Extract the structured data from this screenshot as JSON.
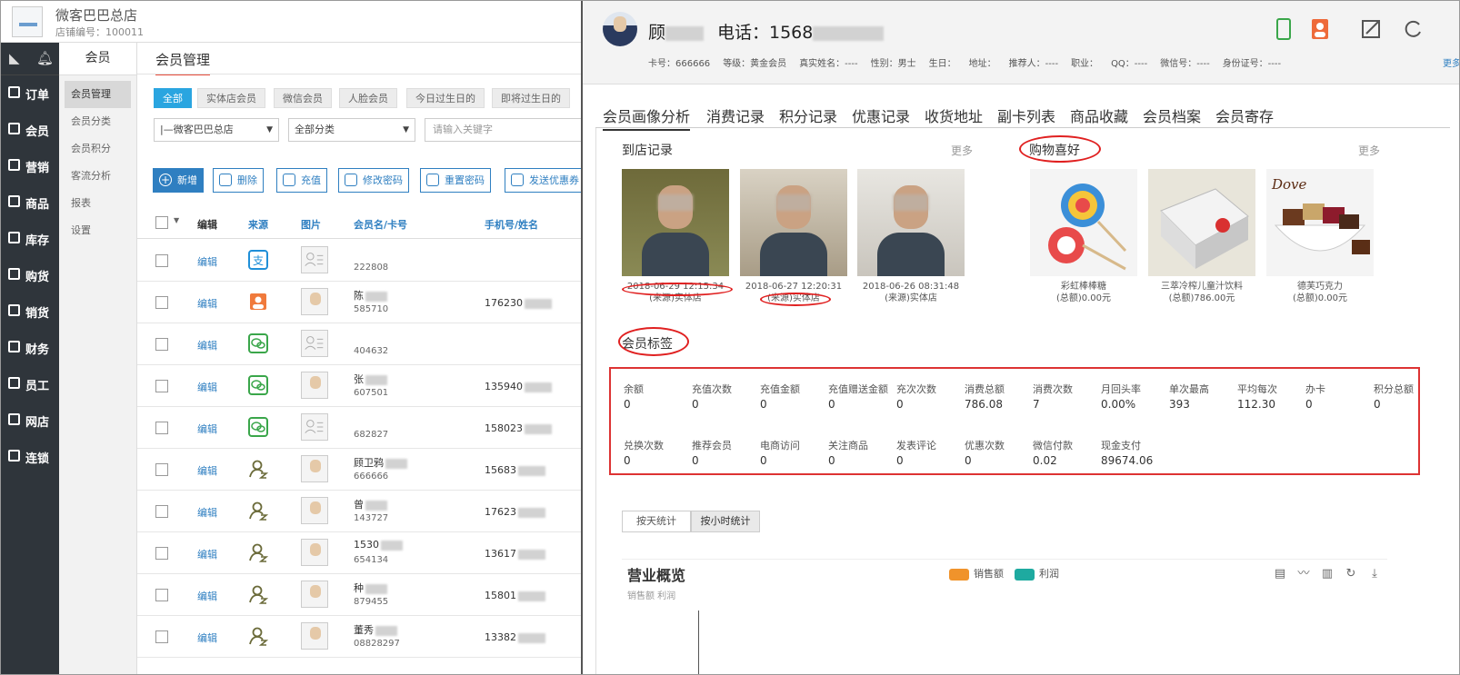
{
  "app": {
    "store_name": "微客巴巴总店",
    "store_no": "店铺编号：100011"
  },
  "nav": {
    "items": [
      {
        "label": "订单",
        "icon": "order-icon"
      },
      {
        "label": "会员",
        "icon": "member-icon"
      },
      {
        "label": "营销",
        "icon": "gift-icon"
      },
      {
        "label": "商品",
        "icon": "product-icon"
      },
      {
        "label": "库存",
        "icon": "warehouse-icon"
      },
      {
        "label": "购货",
        "icon": "purchase-icon"
      },
      {
        "label": "销货",
        "icon": "sales-icon"
      },
      {
        "label": "财务",
        "icon": "finance-icon"
      },
      {
        "label": "员工",
        "icon": "staff-icon"
      },
      {
        "label": "网店",
        "icon": "phone-icon"
      },
      {
        "label": "连锁",
        "icon": "chain-icon"
      }
    ]
  },
  "subnav": {
    "title": "会员",
    "items": [
      "会员管理",
      "会员分类",
      "会员积分",
      "客流分析",
      "报表",
      "设置"
    ]
  },
  "main": {
    "title": "会员管理",
    "filters": [
      "全部",
      "实体店会员",
      "微信会员",
      "人脸会员",
      "今日过生日的",
      "即将过生日的"
    ],
    "store_select": "|—微客巴巴总店",
    "category_select": "全部分类",
    "search_placeholder": "请输入关键字",
    "actions": [
      "新增",
      "删除",
      "充值",
      "修改密码",
      "重置密码",
      "发送优惠券"
    ],
    "columns": {
      "edit": "编辑",
      "source": "来源",
      "picture": "图片",
      "name_card": "会员名/卡号",
      "phone_name": "手机号/姓名"
    },
    "rows": [
      {
        "edit": "编辑",
        "source": "alipay",
        "photo": "placeholder",
        "name": "",
        "card": "222808",
        "phone": ""
      },
      {
        "edit": "编辑",
        "source": "face",
        "photo": "face",
        "name": "陈",
        "card": "585710",
        "phone": "176230"
      },
      {
        "edit": "编辑",
        "source": "wechat",
        "photo": "placeholder",
        "name": "",
        "card": "404632",
        "phone": ""
      },
      {
        "edit": "编辑",
        "source": "wechat",
        "photo": "face",
        "name": "张",
        "card": "607501",
        "phone": "135940"
      },
      {
        "edit": "编辑",
        "source": "wechat",
        "photo": "placeholder",
        "name": "",
        "card": "682827",
        "phone": "158023"
      },
      {
        "edit": "编辑",
        "source": "user",
        "photo": "face",
        "name": "顾卫鸦",
        "card": "666666",
        "phone": "15683"
      },
      {
        "edit": "编辑",
        "source": "user",
        "photo": "face",
        "name": "曾",
        "card": "143727",
        "phone": "17623"
      },
      {
        "edit": "编辑",
        "source": "user",
        "photo": "face",
        "name": "1530",
        "card": "654134",
        "phone": "13617"
      },
      {
        "edit": "编辑",
        "source": "user",
        "photo": "face",
        "name": "种",
        "card": "879455",
        "phone": "15801"
      },
      {
        "edit": "编辑",
        "source": "user",
        "photo": "face",
        "name": "董秀",
        "card": "08828297",
        "phone": "13382"
      }
    ]
  },
  "panel": {
    "name": "顾",
    "phone": "电话：1568",
    "info": [
      "卡号：666666",
      "等级：黄金会员",
      "真实姓名：----",
      "性别：男士",
      "生日：",
      "地址：",
      "推荐人：----",
      "职业：",
      "QQ：----",
      "微信号：----",
      "身份证号：----"
    ],
    "more": "更多",
    "tabs": [
      "会员画像分析",
      "消费记录",
      "积分记录",
      "优惠记录",
      "收货地址",
      "副卡列表",
      "商品收藏",
      "会员档案",
      "会员寄存"
    ],
    "visits_title": "到店记录",
    "visits_more": "更多",
    "visits": [
      {
        "time": "2018-06-29 12:15:34",
        "source": "(来源)实体店"
      },
      {
        "time": "2018-06-27 12:20:31",
        "source": "(来源)实体店"
      },
      {
        "time": "2018-06-26 08:31:48",
        "source": "(来源)实体店"
      }
    ],
    "prefs_title": "购物喜好",
    "prefs_more": "更多",
    "prefs": [
      {
        "name": "彩虹棒棒糖",
        "amount": "(总额)0.00元"
      },
      {
        "name": "三萃冷榨儿童汁饮料",
        "amount": "(总额)786.00元"
      },
      {
        "name": "德芙巧克力",
        "amount": "(总额)0.00元",
        "brand": "Dove"
      }
    ],
    "tags_title": "会员标签",
    "stats": [
      {
        "label": "余额",
        "value": "0"
      },
      {
        "label": "充值次数",
        "value": "0"
      },
      {
        "label": "充值金额",
        "value": "0"
      },
      {
        "label": "充值赠送金额",
        "value": "0"
      },
      {
        "label": "充次次数",
        "value": "0"
      },
      {
        "label": "消费总额",
        "value": "786.08"
      },
      {
        "label": "消费次数",
        "value": "7"
      },
      {
        "label": "月回头率",
        "value": "0.00%"
      },
      {
        "label": "单次最高",
        "value": "393"
      },
      {
        "label": "平均每次",
        "value": "112.30"
      },
      {
        "label": "办卡",
        "value": "0"
      },
      {
        "label": "积分总额",
        "value": "0"
      },
      {
        "label": "兑换次数",
        "value": "0"
      },
      {
        "label": "推荐会员",
        "value": "0"
      },
      {
        "label": "电商访问",
        "value": "0"
      },
      {
        "label": "关注商品",
        "value": "0"
      },
      {
        "label": "发表评论",
        "value": "0"
      },
      {
        "label": "优惠次数",
        "value": "0"
      },
      {
        "label": "微信付款",
        "value": "0.02"
      },
      {
        "label": "现金支付",
        "value": "89674.06"
      }
    ],
    "stat_tabs": [
      "按天统计",
      "按小时统计"
    ],
    "chart": {
      "title": "营业概览",
      "subtitle": "销售额 利润",
      "legend": [
        {
          "name": "销售额",
          "color": "#f0932b"
        },
        {
          "name": "利润",
          "color": "#1eaaa0"
        }
      ]
    }
  }
}
